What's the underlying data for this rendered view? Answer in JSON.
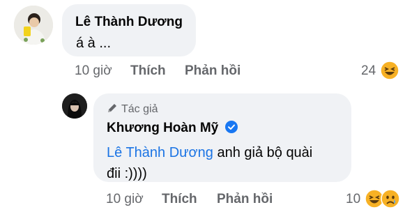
{
  "comment1": {
    "author": "Lê Thành Dương",
    "text": "á à ...",
    "time": "10 giờ",
    "like_label": "Thích",
    "reply_label": "Phản hồi",
    "reaction_count": "24",
    "reaction_icons": [
      "haha-icon"
    ]
  },
  "comment2": {
    "badge": "Tác giả",
    "author": "Khương Hoàn Mỹ",
    "verified": true,
    "mention": "Lê Thành Dương",
    "text_line1": " anh giả bộ quài",
    "text_line2": "đii :))))",
    "time": "10 giờ",
    "like_label": "Thích",
    "reply_label": "Phản hồi",
    "reaction_count": "10",
    "reaction_icons": [
      "haha-icon",
      "sad-icon"
    ]
  },
  "colors": {
    "bubble": "#f0f2f5",
    "meta": "#65676b",
    "mention": "#1b74e4",
    "verified": "#1877f2",
    "reaction": "#f7b125"
  }
}
